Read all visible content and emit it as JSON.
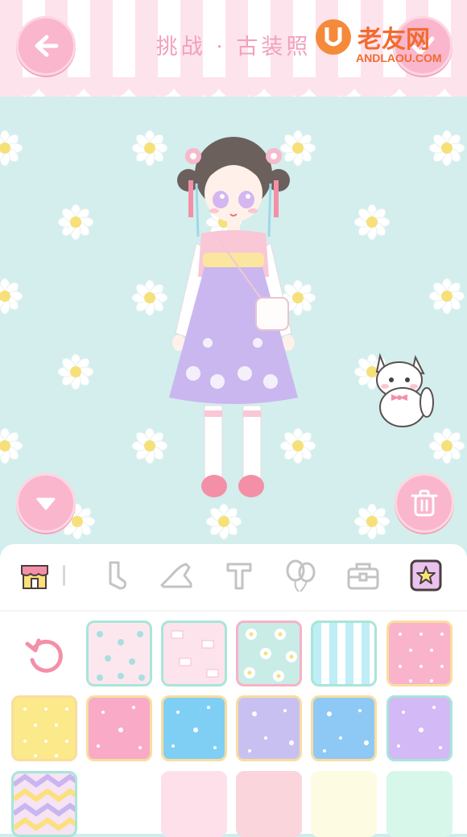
{
  "header": {
    "title": "挑战 · 古装照",
    "back_label": "back",
    "confirm_label": "confirm"
  },
  "watermark": {
    "brand": "老友网",
    "domain": "ANDLAOU.COM"
  },
  "colors": {
    "accent_pink": "#f9b6cc",
    "mint_border": "#a8e6d8",
    "background": "#d3eeec"
  },
  "toolbar": {
    "tabs": [
      {
        "icon": "shop-icon"
      },
      {
        "icon": "sock-icon"
      },
      {
        "icon": "shoe-icon"
      },
      {
        "icon": "text-icon"
      },
      {
        "icon": "balloon-icon"
      },
      {
        "icon": "bag-icon"
      },
      {
        "icon": "background-star-icon",
        "selected": true
      }
    ]
  },
  "swatches": [
    {
      "pattern": "reset"
    },
    {
      "pattern": "pink-rose-dots"
    },
    {
      "pattern": "pink-envelopes"
    },
    {
      "pattern": "mint-daisies"
    },
    {
      "pattern": "blue-white-stripes"
    },
    {
      "pattern": "pink-polka"
    },
    {
      "pattern": "yellow-polka"
    },
    {
      "pattern": "pink-sparkle"
    },
    {
      "pattern": "blue-sparkle"
    },
    {
      "pattern": "lavender-stars"
    },
    {
      "pattern": "blue-stars"
    },
    {
      "pattern": "purple-sparkle"
    },
    {
      "pattern": "pastel-chevron"
    },
    {
      "pattern": "blank"
    },
    {
      "pattern": "light-pink"
    },
    {
      "pattern": "soft-pink"
    },
    {
      "pattern": "cream"
    },
    {
      "pattern": "mint"
    }
  ]
}
